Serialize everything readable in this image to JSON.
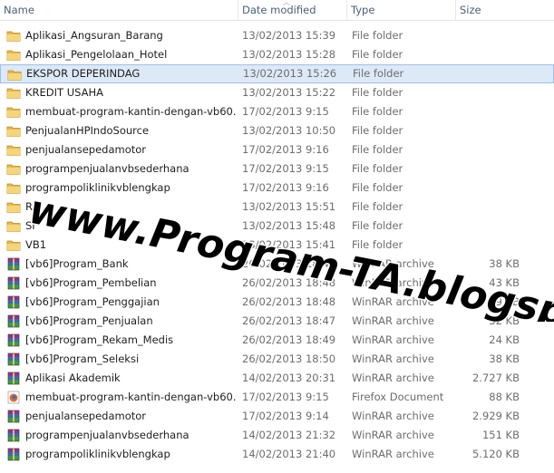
{
  "columns": {
    "name": "Name",
    "date": "Date modified",
    "type": "Type",
    "size": "Size"
  },
  "files": [
    {
      "icon": "folder-icon",
      "name": "Aplikasi_Angsuran_Barang",
      "date": "13/02/2013 15:39",
      "type": "File folder",
      "size": ""
    },
    {
      "icon": "folder-icon",
      "name": "Aplikasi_Pengelolaan_Hotel",
      "date": "13/02/2013 15:28",
      "type": "File folder",
      "size": ""
    },
    {
      "icon": "folder-icon",
      "name": "EKSPOR DEPERINDAG",
      "date": "13/02/2013 15:26",
      "type": "File folder",
      "size": "",
      "selected": true
    },
    {
      "icon": "folder-icon",
      "name": "KREDIT USAHA",
      "date": "13/02/2013 15:22",
      "type": "File folder",
      "size": ""
    },
    {
      "icon": "folder-icon",
      "name": "membuat-program-kantin-dengan-vb60...",
      "date": "17/02/2013 9:15",
      "type": "File folder",
      "size": ""
    },
    {
      "icon": "folder-icon",
      "name": "PenjualanHPIndoSource",
      "date": "13/02/2013 10:50",
      "type": "File folder",
      "size": ""
    },
    {
      "icon": "folder-icon",
      "name": "penjualansepedamotor",
      "date": "17/02/2013 9:16",
      "type": "File folder",
      "size": ""
    },
    {
      "icon": "folder-icon",
      "name": "programpenjualanvbsederhana",
      "date": "17/02/2013 9:15",
      "type": "File folder",
      "size": ""
    },
    {
      "icon": "folder-icon",
      "name": "programpoliklinikvblengkap",
      "date": "17/02/2013 9:16",
      "type": "File folder",
      "size": ""
    },
    {
      "icon": "folder-icon",
      "name": "R",
      "date": "13/02/2013 15:51",
      "type": "File folder",
      "size": ""
    },
    {
      "icon": "folder-icon",
      "name": "SI",
      "date": "13/02/2013 15:48",
      "type": "File folder",
      "size": ""
    },
    {
      "icon": "folder-icon",
      "name": "VB1",
      "date": "13/02/2013 15:41",
      "type": "File folder",
      "size": ""
    },
    {
      "icon": "winrar-archive-icon",
      "name": "[vb6]Program_Bank",
      "date": "26/02/2013 18:48",
      "type": "WinRAR archive",
      "size": "38 KB"
    },
    {
      "icon": "winrar-archive-icon",
      "name": "[vb6]Program_Pembelian",
      "date": "26/02/2013 18:48",
      "type": "WinRAR archive",
      "size": "43 KB"
    },
    {
      "icon": "winrar-archive-icon",
      "name": "[vb6]Program_Penggajian",
      "date": "26/02/2013 18:48",
      "type": "WinRAR archive",
      "size": "29 KB"
    },
    {
      "icon": "winrar-archive-icon",
      "name": "[vb6]Program_Penjualan",
      "date": "26/02/2013 18:47",
      "type": "WinRAR archive",
      "size": "32 KB"
    },
    {
      "icon": "winrar-archive-icon",
      "name": "[vb6]Program_Rekam_Medis",
      "date": "26/02/2013 18:49",
      "type": "WinRAR archive",
      "size": "24 KB"
    },
    {
      "icon": "winrar-archive-icon",
      "name": "[vb6]Program_Seleksi",
      "date": "26/02/2013 18:50",
      "type": "WinRAR archive",
      "size": "38 KB"
    },
    {
      "icon": "winrar-archive-icon",
      "name": "Aplikasi Akademik",
      "date": "14/02/2013 20:31",
      "type": "WinRAR archive",
      "size": "2.727 KB"
    },
    {
      "icon": "firefox-document-icon",
      "name": "membuat-program-kantin-dengan-vb60...",
      "date": "17/02/2013 9:15",
      "type": "Firefox Document",
      "size": "88 KB"
    },
    {
      "icon": "winrar-archive-icon",
      "name": "penjualansepedamotor",
      "date": "17/02/2013 9:14",
      "type": "WinRAR archive",
      "size": "2.929 KB"
    },
    {
      "icon": "winrar-archive-icon",
      "name": "programpenjualanvbsederhana",
      "date": "14/02/2013 21:32",
      "type": "WinRAR archive",
      "size": "151 KB"
    },
    {
      "icon": "winrar-archive-icon",
      "name": "programpoliklinikvblengkap",
      "date": "14/02/2013 21:40",
      "type": "WinRAR archive",
      "size": "5.120 KB"
    }
  ],
  "watermark": "www.Program-TA.blogspot.com"
}
